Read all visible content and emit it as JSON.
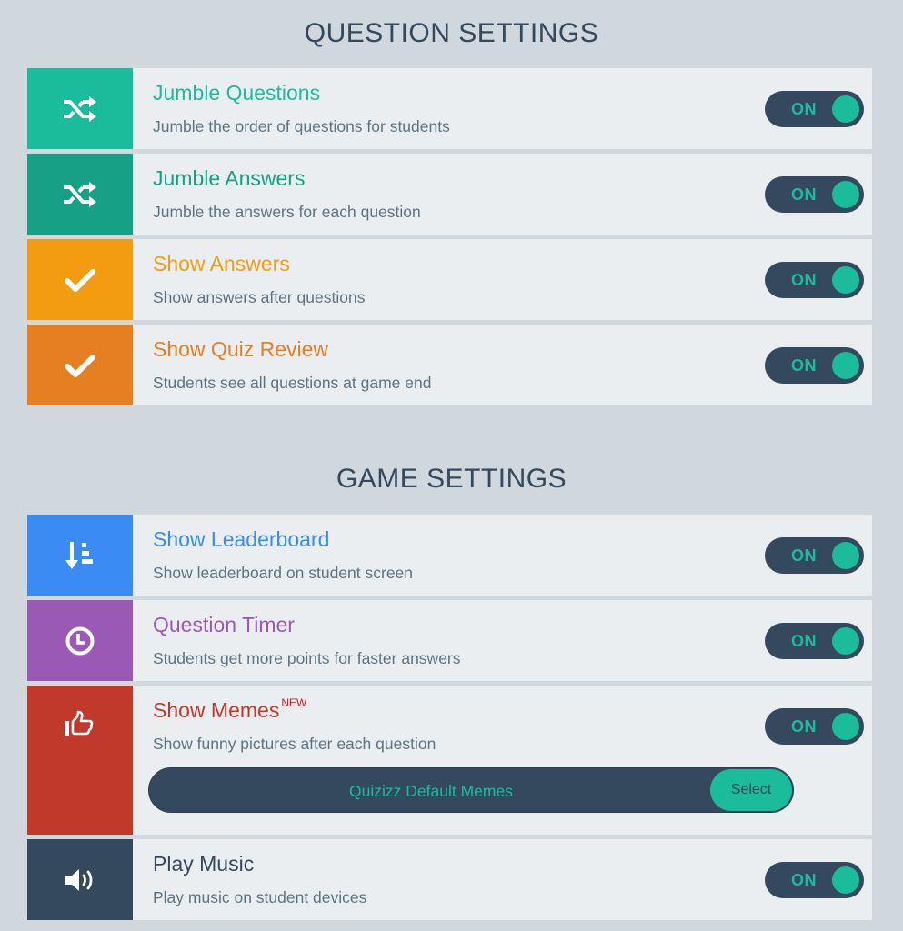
{
  "sections": [
    {
      "title": "QUESTION SETTINGS",
      "items": [
        {
          "title": "Jumble Questions",
          "description": "Jumble the order of questions for students",
          "icon": "shuffle-icon",
          "color": "#1abc9c",
          "toggle": "ON"
        },
        {
          "title": "Jumble Answers",
          "description": "Jumble the answers for each question",
          "icon": "shuffle-icon",
          "color": "#16a085",
          "toggle": "ON"
        },
        {
          "title": "Show Answers",
          "description": "Show answers after questions",
          "icon": "checkmark-icon",
          "color": "#f39c12",
          "toggle": "ON"
        },
        {
          "title": "Show Quiz Review",
          "description": "Students see all questions at game end",
          "icon": "checkmark-icon",
          "color": "#e67e22",
          "toggle": "ON"
        }
      ]
    },
    {
      "title": "GAME SETTINGS",
      "items": [
        {
          "title": "Show Leaderboard",
          "description": "Show leaderboard on student screen",
          "icon": "leaderboard-sort-icon",
          "color": "#3b8bf5",
          "toggle": "ON"
        },
        {
          "title": "Question Timer",
          "description": "Students get more points for faster answers",
          "icon": "clock-icon",
          "color": "#9b59b6",
          "toggle": "ON"
        },
        {
          "title": "Show Memes",
          "badge": "NEW",
          "description": "Show funny pictures after each question",
          "icon": "thumbs-up-icon",
          "color": "#c0392b",
          "toggle": "ON",
          "meme_set": {
            "name": "Quizizz Default Memes",
            "button": "Select"
          }
        },
        {
          "title": "Play Music",
          "description": "Play music on student devices",
          "icon": "speaker-icon",
          "color": "#34495e",
          "title_color": "#34495e",
          "toggle": "ON"
        }
      ]
    }
  ],
  "colors": {
    "background": "#d0d8de",
    "row_background": "#ebeef1",
    "toggle_track": "#34495e",
    "toggle_on": "#1abc9c",
    "description": "#5c7483",
    "badge": "#e3121a"
  }
}
